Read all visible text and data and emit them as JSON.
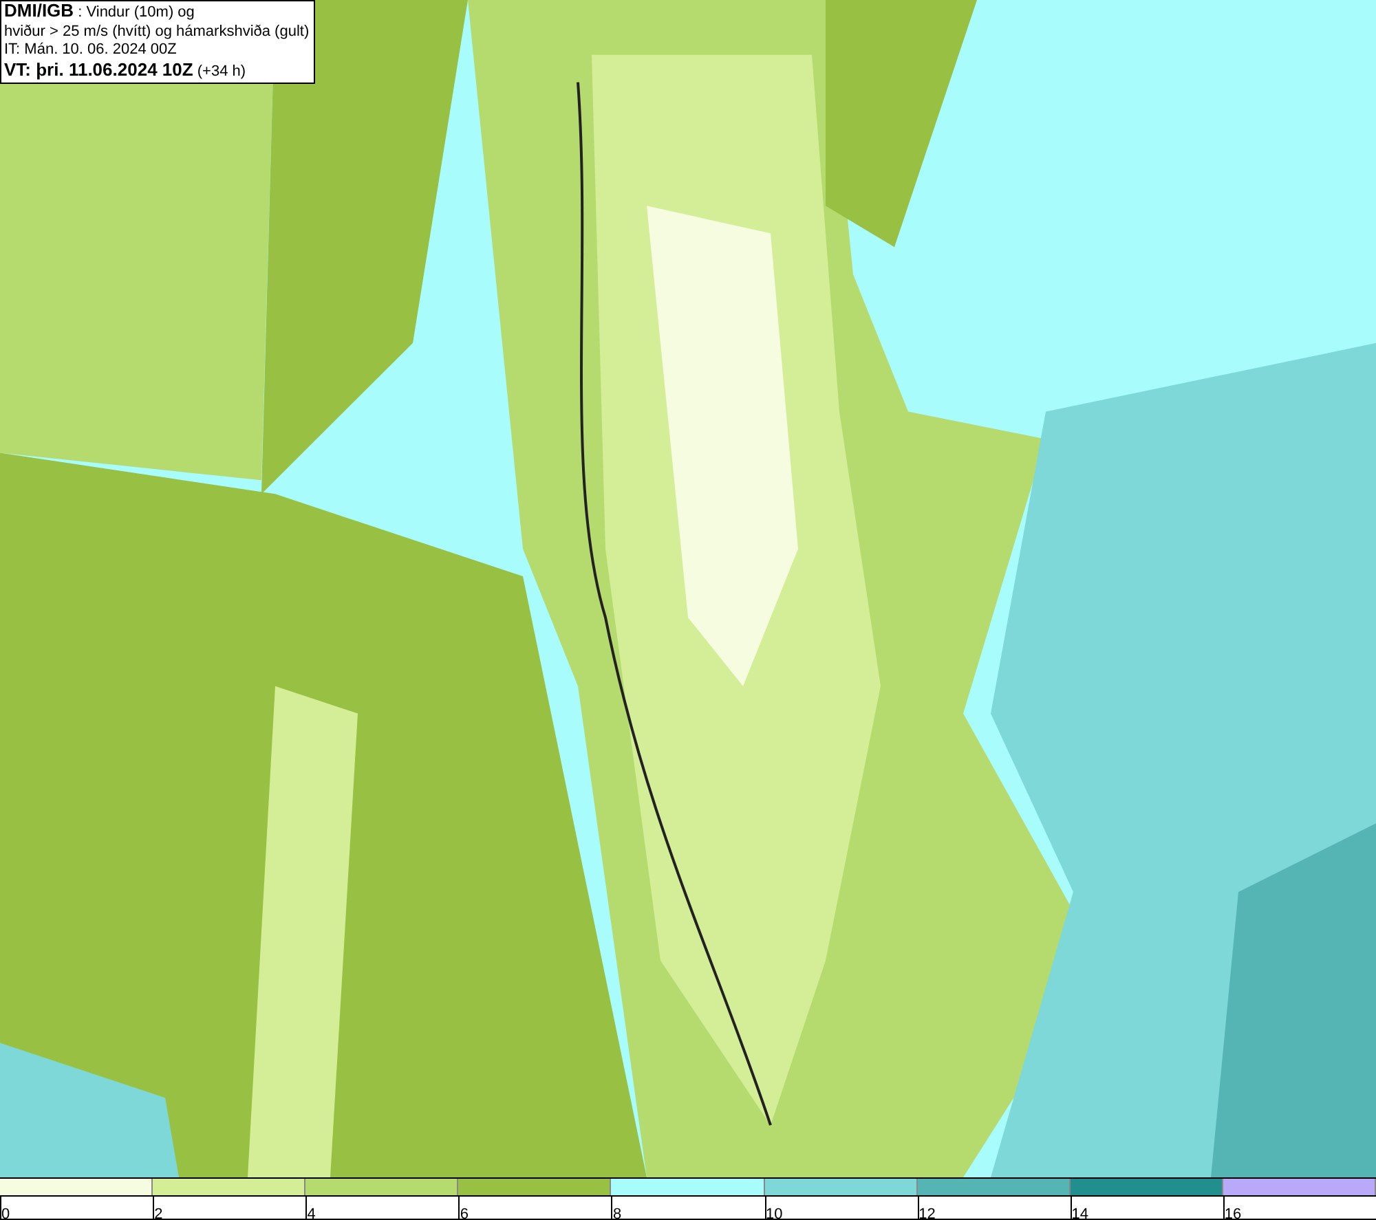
{
  "header": {
    "lines": [
      "**DMI/IGB** : Vindur (10m) og",
      "hviður > 25 m/s (hvítt) og hámarkshviða (gult)",
      "IT: Mán. 10. 06. 2024 00Z",
      "**VT: þri. 11.06.2024 10Z** (+34 h)"
    ]
  },
  "legend": [
    {
      "label": "0",
      "color": "#f5fce0"
    },
    {
      "label": "2",
      "color": "#d4ee98"
    },
    {
      "label": "4",
      "color": "#b5da6e"
    },
    {
      "label": "6",
      "color": "#98c043"
    },
    {
      "label": "8",
      "color": "#a8fcfc"
    },
    {
      "label": "10",
      "color": "#7ed8d8"
    },
    {
      "label": "12",
      "color": "#55b4b4"
    },
    {
      "label": "14",
      "color": "#228f8f"
    },
    {
      "label": "16",
      "color": "#b9a9f9"
    }
  ]
}
